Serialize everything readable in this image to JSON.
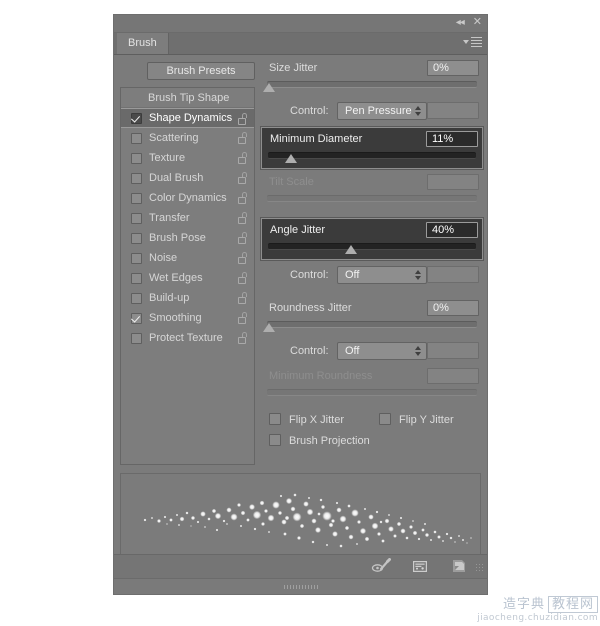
{
  "window": {
    "title": "Brush",
    "collapse_icon": "collapse-double-chevron-icon",
    "close_icon": "close-icon",
    "panel_menu_icon": "panel-menu-icon"
  },
  "left": {
    "presets_button": "Brush Presets",
    "header": "Brush Tip Shape",
    "options": [
      {
        "label": "Shape Dynamics",
        "checked": true,
        "selected": true,
        "locked": false
      },
      {
        "label": "Scattering",
        "checked": false,
        "selected": false,
        "locked": false
      },
      {
        "label": "Texture",
        "checked": false,
        "selected": false,
        "locked": false
      },
      {
        "label": "Dual Brush",
        "checked": false,
        "selected": false,
        "locked": false
      },
      {
        "label": "Color Dynamics",
        "checked": false,
        "selected": false,
        "locked": false
      },
      {
        "label": "Transfer",
        "checked": false,
        "selected": false,
        "locked": false
      },
      {
        "label": "Brush Pose",
        "checked": false,
        "selected": false,
        "locked": false
      },
      {
        "label": "Noise",
        "checked": false,
        "selected": false,
        "locked": false
      },
      {
        "label": "Wet Edges",
        "checked": false,
        "selected": false,
        "locked": false
      },
      {
        "label": "Build-up",
        "checked": false,
        "selected": false,
        "locked": false
      },
      {
        "label": "Smoothing",
        "checked": true,
        "selected": false,
        "locked": false
      },
      {
        "label": "Protect Texture",
        "checked": false,
        "selected": false,
        "locked": false
      }
    ]
  },
  "controls": {
    "size_jitter": {
      "label": "Size Jitter",
      "value": "0%",
      "percent": 0
    },
    "size_control": {
      "label": "Control:",
      "value": "Pen Pressure"
    },
    "minimum_diameter": {
      "label": "Minimum Diameter",
      "value": "11%",
      "percent": 11,
      "highlighted": true
    },
    "tilt_scale": {
      "label": "Tilt Scale",
      "value": "",
      "percent": 0,
      "disabled": true
    },
    "angle_jitter": {
      "label": "Angle Jitter",
      "value": "40%",
      "percent": 40,
      "highlighted": true
    },
    "angle_control": {
      "label": "Control:",
      "value": "Off"
    },
    "roundness_jitter": {
      "label": "Roundness Jitter",
      "value": "0%",
      "percent": 0
    },
    "roundness_control": {
      "label": "Control:",
      "value": "Off"
    },
    "minimum_roundness": {
      "label": "Minimum Roundness",
      "value": "",
      "disabled": true
    },
    "flip_x": {
      "label": "Flip X Jitter",
      "checked": false
    },
    "flip_y": {
      "label": "Flip Y Jitter",
      "checked": false
    },
    "brush_projection": {
      "label": "Brush Projection",
      "checked": false
    }
  },
  "footer": {
    "toggle_preview_icon": "brush-preview-toggle-icon",
    "new_preset_icon": "new-brush-preset-icon",
    "delete_brush_icon": "delete-brush-icon",
    "grip_icon": "panel-grip-icon",
    "resize_grip_icon": "resize-grip-icon"
  },
  "watermark": {
    "text_left": "造字典",
    "text_right": "教程网",
    "url": "jiaocheng.chuzidian.com"
  },
  "colors": {
    "panel_bg": "#7b7b7b",
    "list_bg": "#7d7d7d",
    "selected_row": "#6a6a6a",
    "highlight_block": "#3b3b3b",
    "text": "#dcdcdc"
  }
}
